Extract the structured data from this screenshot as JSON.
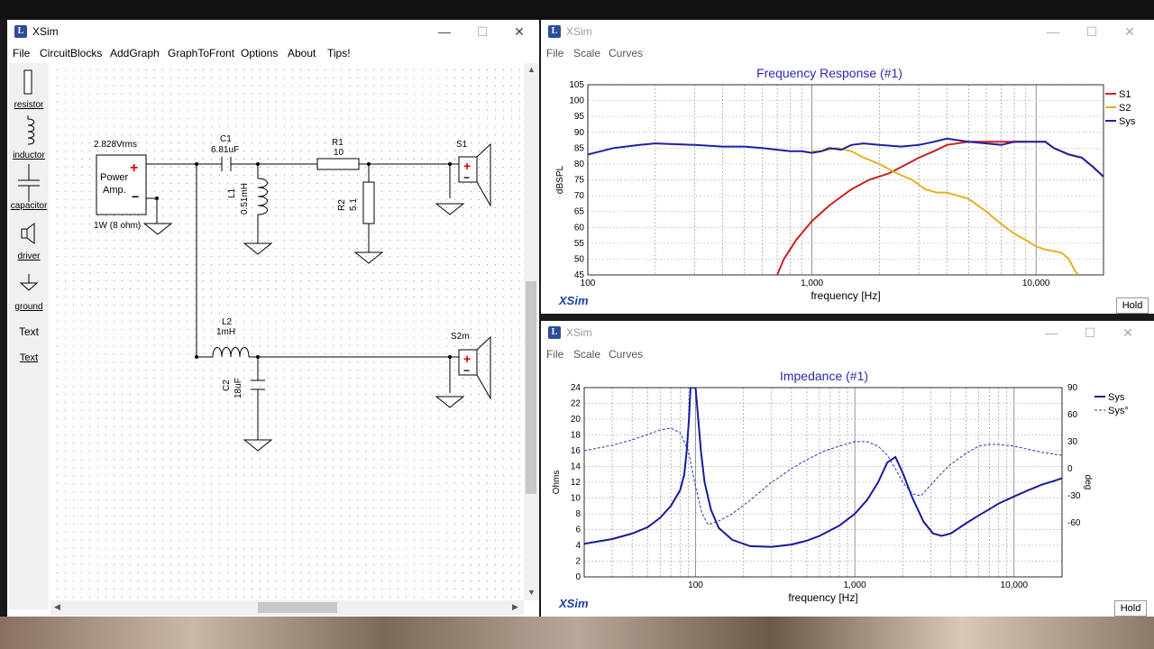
{
  "circuit_window": {
    "title": "XSim",
    "menu": [
      "File",
      "CircuitBlocks",
      "AddGraph",
      "GraphToFront",
      "Options",
      "About",
      "Tips!"
    ],
    "palette": [
      "resistor",
      "inductor",
      "capacitor",
      "driver",
      "ground",
      "Text"
    ],
    "palette_text_sample": "Text",
    "components": {
      "source_voltage": "2.828Vrms",
      "amp_line1": "Power",
      "amp_line2": "Amp.",
      "amp_power": "1W (8 ohm)",
      "c1_name": "C1",
      "c1_value": "6.81uF",
      "r1_name": "R1",
      "r1_value": "10",
      "l1_name": "L1",
      "l1_value": "0.51mH",
      "r2_name": "R2",
      "r2_value": "5.1",
      "s1_name": "S1",
      "l2_name": "L2",
      "l2_value": "1mH",
      "c2_name": "C2",
      "c2_value": "18uF",
      "s2_name": "S2m",
      "plus": "+",
      "minus": "−"
    }
  },
  "freq_window": {
    "title": "XSim",
    "menu": [
      "File",
      "Scale",
      "Curves"
    ],
    "graph_title": "Frequency Response (#1)",
    "ylabel": "dBSPL",
    "xlabel": "frequency [Hz]",
    "brand": "XSim",
    "hold": "Hold"
  },
  "imp_window": {
    "title": "XSim",
    "menu": [
      "File",
      "Scale",
      "Curves"
    ],
    "graph_title": "Impedance (#1)",
    "ylabel": "Ohms",
    "y2label": "deg",
    "xlabel": "frequency [Hz]",
    "brand": "XSim",
    "hold": "Hold"
  },
  "chart_data": [
    {
      "type": "line",
      "title": "Frequency Response (#1)",
      "xlabel": "frequency [Hz]",
      "ylabel": "dBSPL",
      "xscale": "log",
      "xlim": [
        100,
        20000
      ],
      "ylim": [
        45,
        105
      ],
      "yticks": [
        45,
        50,
        55,
        60,
        65,
        70,
        75,
        80,
        85,
        90,
        95,
        100,
        105
      ],
      "xtick_labels": [
        "100",
        "1,000",
        "10,000"
      ],
      "legend_position": "right",
      "series": [
        {
          "name": "S1",
          "color": "#cc2020",
          "points": [
            [
              700,
              45
            ],
            [
              750,
              50
            ],
            [
              850,
              56
            ],
            [
              1000,
              62
            ],
            [
              1200,
              67
            ],
            [
              1500,
              72
            ],
            [
              1800,
              75
            ],
            [
              2200,
              77
            ],
            [
              2500,
              79
            ],
            [
              3000,
              82
            ],
            [
              3500,
              84
            ],
            [
              4000,
              86
            ],
            [
              5000,
              87
            ],
            [
              6000,
              87
            ],
            [
              7000,
              87
            ],
            [
              8000,
              87
            ],
            [
              9000,
              87
            ],
            [
              10000,
              87
            ],
            [
              11000,
              87
            ],
            [
              12000,
              85
            ],
            [
              14000,
              83
            ],
            [
              16000,
              82
            ],
            [
              18000,
              79
            ],
            [
              20000,
              76
            ]
          ]
        },
        {
          "name": "S2",
          "color": "#e8b020",
          "points": [
            [
              1000,
              84
            ],
            [
              1100,
              84
            ],
            [
              1300,
              85
            ],
            [
              1500,
              84
            ],
            [
              1700,
              82
            ],
            [
              2000,
              80
            ],
            [
              2400,
              77
            ],
            [
              2800,
              75
            ],
            [
              3200,
              72
            ],
            [
              3600,
              71
            ],
            [
              4000,
              71
            ],
            [
              5000,
              69
            ],
            [
              6000,
              65
            ],
            [
              7000,
              61
            ],
            [
              8000,
              58
            ],
            [
              9000,
              56
            ],
            [
              10000,
              54
            ],
            [
              11000,
              53
            ],
            [
              13000,
              52
            ],
            [
              14000,
              50
            ],
            [
              15000,
              46
            ],
            [
              15500,
              45
            ]
          ]
        },
        {
          "name": "Sys",
          "color": "#1f1fa0",
          "points": [
            [
              100,
              83
            ],
            [
              130,
              85
            ],
            [
              170,
              86
            ],
            [
              200,
              86.5
            ],
            [
              300,
              86
            ],
            [
              400,
              85.5
            ],
            [
              500,
              85.5
            ],
            [
              600,
              85
            ],
            [
              700,
              84.5
            ],
            [
              800,
              84
            ],
            [
              900,
              84
            ],
            [
              1000,
              83.5
            ],
            [
              1100,
              84
            ],
            [
              1200,
              85
            ],
            [
              1350,
              84.5
            ],
            [
              1500,
              86
            ],
            [
              1700,
              86.5
            ],
            [
              2000,
              86
            ],
            [
              2500,
              85.5
            ],
            [
              3000,
              86
            ],
            [
              3500,
              87
            ],
            [
              4000,
              88
            ],
            [
              5000,
              87
            ],
            [
              6000,
              86.5
            ],
            [
              7000,
              86
            ],
            [
              8000,
              87
            ],
            [
              9000,
              87
            ],
            [
              10000,
              87
            ],
            [
              11000,
              87
            ],
            [
              12000,
              85
            ],
            [
              14000,
              83
            ],
            [
              16000,
              82
            ],
            [
              18000,
              79
            ],
            [
              20000,
              76
            ]
          ]
        }
      ]
    },
    {
      "type": "line",
      "title": "Impedance (#1)",
      "xlabel": "frequency [Hz]",
      "ylabel": "Ohms",
      "y2label": "deg",
      "xscale": "log",
      "xlim": [
        20,
        20000
      ],
      "ylim": [
        0,
        24
      ],
      "y2lim": [
        -120,
        90
      ],
      "yticks": [
        0,
        2,
        4,
        6,
        8,
        10,
        12,
        14,
        16,
        18,
        20,
        22,
        24
      ],
      "y2ticks": [
        -60,
        -30,
        0,
        30,
        60,
        90
      ],
      "xtick_labels": [
        "100",
        "1,000",
        "10,000"
      ],
      "legend_position": "right",
      "series": [
        {
          "name": "Sys",
          "color": "#1a1a9c",
          "axis": "left",
          "points": [
            [
              20,
              4.2
            ],
            [
              30,
              4.8
            ],
            [
              40,
              5.5
            ],
            [
              50,
              6.3
            ],
            [
              60,
              7.5
            ],
            [
              70,
              9
            ],
            [
              80,
              11
            ],
            [
              85,
              13
            ],
            [
              88,
              16
            ],
            [
              91,
              20
            ],
            [
              93,
              24
            ],
            [
              100,
              24
            ],
            [
              104,
              20
            ],
            [
              108,
              16
            ],
            [
              114,
              12
            ],
            [
              125,
              8.5
            ],
            [
              140,
              6.2
            ],
            [
              170,
              4.7
            ],
            [
              220,
              3.9
            ],
            [
              300,
              3.8
            ],
            [
              400,
              4.1
            ],
            [
              500,
              4.6
            ],
            [
              600,
              5.2
            ],
            [
              800,
              6.5
            ],
            [
              1000,
              8
            ],
            [
              1200,
              9.8
            ],
            [
              1400,
              12
            ],
            [
              1600,
              14.5
            ],
            [
              1800,
              15.2
            ],
            [
              2000,
              13.2
            ],
            [
              2300,
              10
            ],
            [
              2700,
              7
            ],
            [
              3100,
              5.5
            ],
            [
              3500,
              5.2
            ],
            [
              4000,
              5.5
            ],
            [
              5000,
              6.8
            ],
            [
              6000,
              7.8
            ],
            [
              7000,
              8.6
            ],
            [
              8000,
              9.3
            ],
            [
              10000,
              10.2
            ],
            [
              12000,
              10.9
            ],
            [
              15000,
              11.7
            ],
            [
              18000,
              12.2
            ],
            [
              20000,
              12.5
            ]
          ]
        },
        {
          "name": "Sys°",
          "color": "#3030b0",
          "axis": "right",
          "points": [
            [
              20,
              20
            ],
            [
              30,
              26
            ],
            [
              40,
              32
            ],
            [
              50,
              38
            ],
            [
              60,
              43
            ],
            [
              70,
              45
            ],
            [
              80,
              40
            ],
            [
              90,
              20
            ],
            [
              100,
              -20
            ],
            [
              110,
              -50
            ],
            [
              120,
              -62
            ],
            [
              140,
              -58
            ],
            [
              170,
              -50
            ],
            [
              220,
              -35
            ],
            [
              300,
              -15
            ],
            [
              400,
              0
            ],
            [
              500,
              10
            ],
            [
              650,
              20
            ],
            [
              800,
              25
            ],
            [
              1000,
              30
            ],
            [
              1200,
              30
            ],
            [
              1400,
              25
            ],
            [
              1600,
              15
            ],
            [
              1800,
              0
            ],
            [
              2000,
              -15
            ],
            [
              2300,
              -28
            ],
            [
              2600,
              -30
            ],
            [
              3000,
              -18
            ],
            [
              3500,
              -5
            ],
            [
              4000,
              5
            ],
            [
              5000,
              17
            ],
            [
              6000,
              25
            ],
            [
              7000,
              27
            ],
            [
              8000,
              27
            ],
            [
              10000,
              25
            ],
            [
              12000,
              22
            ],
            [
              15000,
              18
            ],
            [
              18000,
              16
            ],
            [
              20000,
              15
            ]
          ]
        }
      ]
    }
  ]
}
